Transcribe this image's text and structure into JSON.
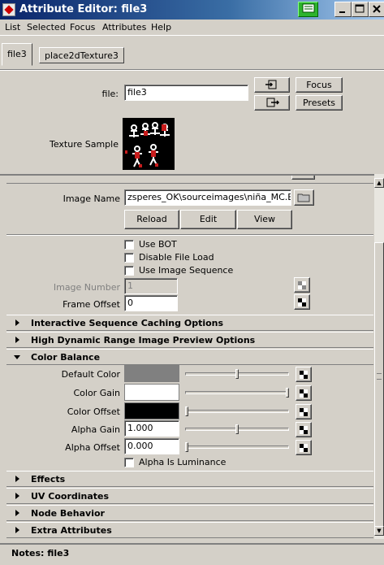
{
  "window": {
    "title": "Attribute Editor: file3"
  },
  "menu": [
    "List",
    "Selected",
    "Focus",
    "Attributes",
    "Help"
  ],
  "tabs": [
    "file3",
    "place2dTexture3"
  ],
  "upper": {
    "file_label": "file:",
    "file_value": "file3",
    "focus_label": "Focus",
    "presets_label": "Presets",
    "texture_sample_label": "Texture Sample"
  },
  "image": {
    "image_name_label": "Image Name",
    "image_name_value": "zsperes_OK\\sourceimages\\niña_MC.BMP",
    "reload_label": "Reload",
    "edit_label": "Edit",
    "view_label": "View",
    "use_bot_label": "Use BOT",
    "disable_file_load_label": "Disable File Load",
    "use_image_sequence_label": "Use Image Sequence",
    "image_number_label": "Image Number",
    "image_number_value": "1",
    "frame_offset_label": "Frame Offset",
    "frame_offset_value": "0"
  },
  "sections": {
    "interactive_caching": "Interactive Sequence Caching Options",
    "hdr_preview": "High Dynamic Range Image Preview Options",
    "color_balance": "Color Balance",
    "effects": "Effects",
    "uv_coordinates": "UV Coordinates",
    "node_behavior": "Node Behavior",
    "extra_attributes": "Extra Attributes"
  },
  "color_balance": {
    "default_color_label": "Default Color",
    "default_color": "#808080",
    "default_color_slider": 0.5,
    "color_gain_label": "Color Gain",
    "color_gain": "#ffffff",
    "color_gain_slider": 1.0,
    "color_offset_label": "Color Offset",
    "color_offset": "#000000",
    "color_offset_slider": 0.0,
    "alpha_gain_label": "Alpha Gain",
    "alpha_gain_value": "1.000",
    "alpha_gain_slider": 0.5,
    "alpha_offset_label": "Alpha Offset",
    "alpha_offset_value": "0.000",
    "alpha_offset_slider": 0.0,
    "alpha_is_luminance_label": "Alpha Is Luminance"
  },
  "notes": {
    "label": "Notes:  file3"
  }
}
